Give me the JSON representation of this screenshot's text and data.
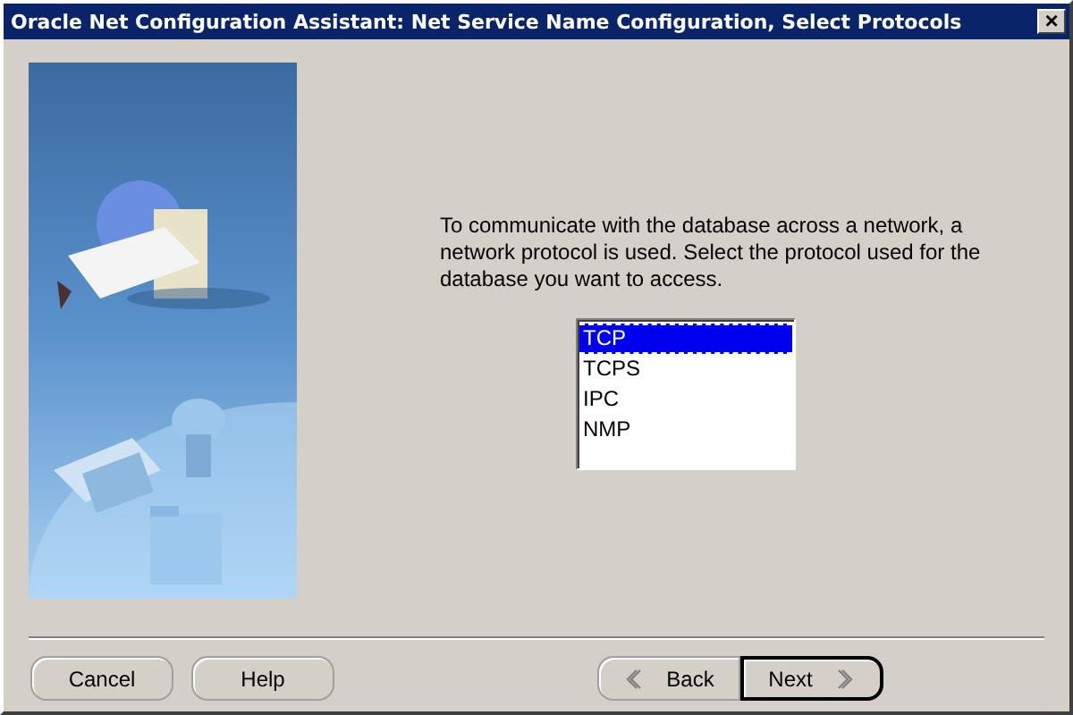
{
  "window": {
    "title": "Oracle Net Configuration Assistant: Net Service Name Configuration, Select Protocols",
    "close": "×"
  },
  "instructions": "To communicate with the database across a network, a network protocol is used. Select the protocol used for the database you want to access.",
  "protocols": [
    {
      "label": "TCP",
      "selected": true
    },
    {
      "label": "TCPS",
      "selected": false
    },
    {
      "label": "IPC",
      "selected": false
    },
    {
      "label": "NMP",
      "selected": false
    }
  ],
  "buttons_left": [
    {
      "label": "Cancel",
      "default": false
    },
    {
      "label": "Help",
      "default": false
    }
  ],
  "buttons_right": [
    {
      "label": "Back",
      "kind": "back",
      "default": false
    },
    {
      "label": "Next",
      "kind": "next",
      "default": true
    }
  ]
}
